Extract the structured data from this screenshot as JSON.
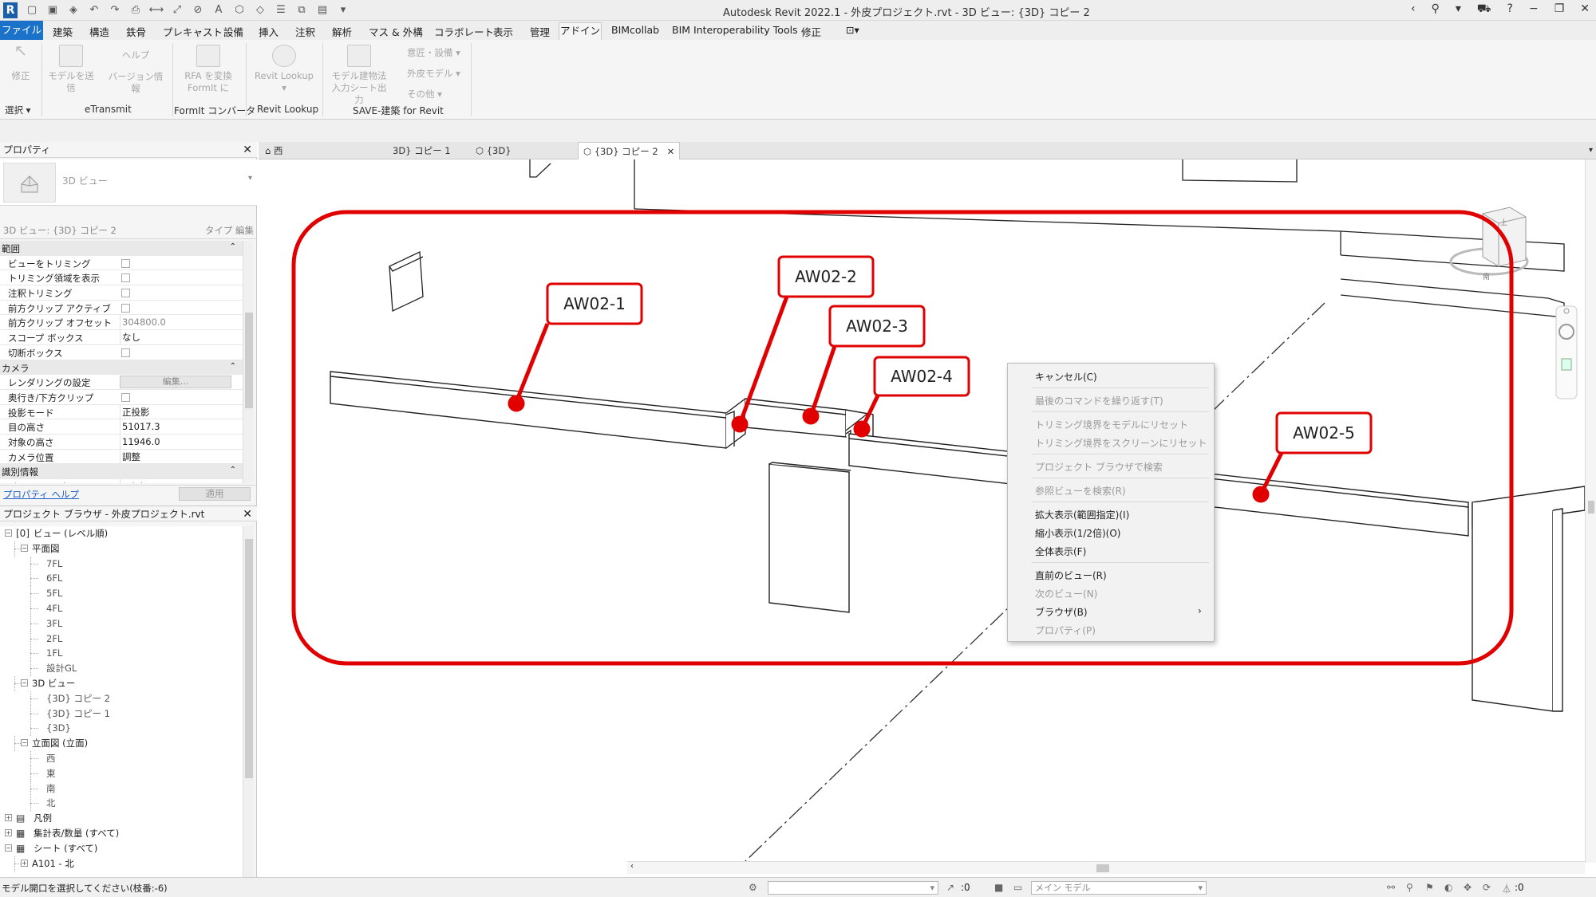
{
  "window": {
    "title": "Autodesk Revit 2022.1 - 外皮プロジェクト.rvt - 3D ビュー: {3D} コピー 2",
    "logo": "R"
  },
  "menu": {
    "file": "ファイル",
    "tabs": [
      "建築",
      "構造",
      "鉄骨",
      "プレキャスト",
      "設備",
      "挿入",
      "注釈",
      "解析",
      "マス & 外構",
      "コラボレート",
      "表示",
      "管理",
      "アドイン",
      "BIMcollab",
      "BIM Interoperability Tools",
      "修正"
    ],
    "active": "アドイン"
  },
  "ribbon": {
    "modify": "修正",
    "select": "選択 ▾",
    "send_model": "モデルを送信",
    "help": "ヘルプ",
    "version": "バージョン情報",
    "etransmit": "eTransmit",
    "rfa_convert_1": "RFA を変換",
    "rfa_convert_2": "FormIt に",
    "formit_converter": "FormIt コンバータ",
    "revit_lookup_btn": "Revit Lookup",
    "revit_lookup_panel": "Revit Lookup",
    "model_building_1": "モデル建物法",
    "model_building_2": "入力シート出力",
    "design_setting": "意匠・設備 ▾",
    "skin_model": "外皮モデル ▾",
    "other": "その他 ▾",
    "save_panel": "SAVE-建築 for Revit"
  },
  "properties": {
    "title": "プロパティ",
    "type_name": "3D ビュー",
    "view_selector": "3D ビュー: {3D} コピー 2",
    "edit_type": "タイプ 編集",
    "rows": [
      {
        "kind": "group",
        "label": "範囲"
      },
      {
        "kind": "check",
        "label": "ビューをトリミング"
      },
      {
        "kind": "check",
        "label": "トリミング領域を表示"
      },
      {
        "kind": "check",
        "label": "注釈トリミング"
      },
      {
        "kind": "check",
        "label": "前方クリップ アクティブ"
      },
      {
        "kind": "value",
        "label": "前方クリップ オフセット",
        "value": "304800.0",
        "dim": true
      },
      {
        "kind": "value",
        "label": "スコープ ボックス",
        "value": "なし"
      },
      {
        "kind": "check",
        "label": "切断ボックス"
      },
      {
        "kind": "group",
        "label": "カメラ"
      },
      {
        "kind": "button",
        "label": "レンダリングの設定",
        "value": "編集..."
      },
      {
        "kind": "check",
        "label": "奥行き/下方クリップ"
      },
      {
        "kind": "value",
        "label": "投影モード",
        "value": "正投影"
      },
      {
        "kind": "value",
        "label": "目の高さ",
        "value": "51017.3"
      },
      {
        "kind": "value",
        "label": "対象の高さ",
        "value": "11946.0"
      },
      {
        "kind": "value",
        "label": "カメラ位置",
        "value": "調整"
      },
      {
        "kind": "group",
        "label": "識別情報"
      },
      {
        "kind": "value",
        "label": "ビュー テンプレート",
        "value": "<なし>",
        "dim": true
      }
    ],
    "help_link": "プロパティ ヘルプ",
    "apply": "適用"
  },
  "browser": {
    "title": "プロジェクト ブラウザ - 外皮プロジェクト.rvt",
    "items": [
      {
        "label": "ビュー (レベル順)",
        "level": 0,
        "toggle": "−",
        "icon": "[0]"
      },
      {
        "label": "平面図",
        "level": 1,
        "toggle": "−"
      },
      {
        "label": "7FL",
        "level": 2
      },
      {
        "label": "6FL",
        "level": 2
      },
      {
        "label": "5FL",
        "level": 2
      },
      {
        "label": "4FL",
        "level": 2
      },
      {
        "label": "3FL",
        "level": 2
      },
      {
        "label": "2FL",
        "level": 2
      },
      {
        "label": "1FL",
        "level": 2
      },
      {
        "label": "設計GL",
        "level": 2
      },
      {
        "label": "3D ビュー",
        "level": 1,
        "toggle": "−"
      },
      {
        "label": "{3D} コピー 2",
        "level": 2
      },
      {
        "label": "{3D} コピー 1",
        "level": 2
      },
      {
        "label": "{3D}",
        "level": 2
      },
      {
        "label": "立面図 (立面)",
        "level": 1,
        "toggle": "−"
      },
      {
        "label": "西",
        "level": 2
      },
      {
        "label": "東",
        "level": 2
      },
      {
        "label": "南",
        "level": 2
      },
      {
        "label": "北",
        "level": 2
      },
      {
        "label": "凡例",
        "level": 0,
        "toggle": "+",
        "icon": "▤"
      },
      {
        "label": "集計表/数量 (すべて)",
        "level": 0,
        "toggle": "+",
        "icon": "▦"
      },
      {
        "label": "シート (すべて)",
        "level": 0,
        "toggle": "−",
        "icon": "▦"
      },
      {
        "label": "A101 - 北",
        "level": 1,
        "toggle": "+"
      }
    ]
  },
  "view_tabs": [
    {
      "label": "西",
      "icon": "⌂"
    },
    {
      "label": "3D} コピー 1"
    },
    {
      "label": "{3D}",
      "icon": "⬡"
    },
    {
      "label": "{3D} コピー 2",
      "icon": "⬡",
      "active": true,
      "close": "✕"
    }
  ],
  "annotations": [
    "AW02-1",
    "AW02-2",
    "AW02-3",
    "AW02-4",
    "AW02-5"
  ],
  "context_menu": {
    "items": [
      {
        "label": "キャンセル(C)",
        "enabled": true
      },
      {
        "label": "最後のコマンドを繰り返す(T)",
        "enabled": false
      },
      {
        "label": "トリミング境界をモデルにリセット",
        "enabled": false
      },
      {
        "label": "トリミング境界をスクリーンにリセット",
        "enabled": false
      },
      {
        "label": "プロジェクト ブラウザで検索",
        "enabled": false
      },
      {
        "label": "参照ビューを検索(R)",
        "enabled": false
      },
      {
        "label": "拡大表示(範囲指定)(I)",
        "enabled": true
      },
      {
        "label": "縮小表示(1/2倍)(O)",
        "enabled": true
      },
      {
        "label": "全体表示(F)",
        "enabled": true
      },
      {
        "label": "直前のビュー(R)",
        "enabled": true
      },
      {
        "label": "次のビュー(N)",
        "enabled": false
      },
      {
        "label": "ブラウザ(B)",
        "enabled": true,
        "submenu": "›"
      },
      {
        "label": "プロパティ(P)",
        "enabled": false
      }
    ]
  },
  "status": {
    "message": "モデル開口を選択してください(枝番:-6)",
    "count": ":0",
    "model_combo": "メイン モデル",
    "filter_count": ":0"
  },
  "colors": {
    "accent": "#1a73c8",
    "annotation": "#e00000"
  }
}
